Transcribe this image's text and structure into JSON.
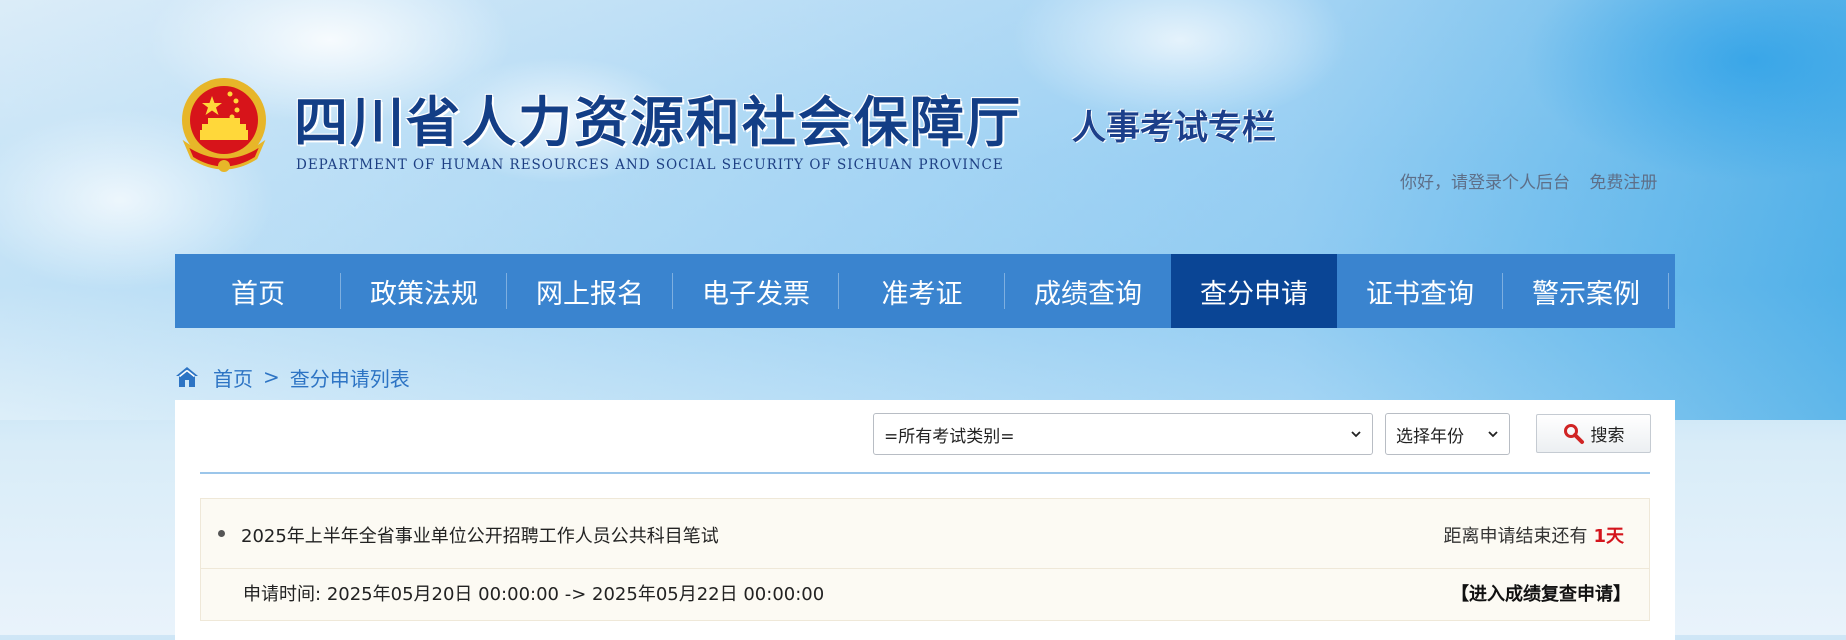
{
  "header": {
    "title": "四川省人力资源和社会保障厅",
    "subtitle": "DEPARTMENT OF HUMAN RESOURCES AND SOCIAL SECURITY OF SICHUAN PROVINCE",
    "column": "人事考试专栏",
    "emblem_icon": "national-emblem-icon",
    "login_link": "你好，请登录个人后台",
    "register_link": "免费注册"
  },
  "nav": {
    "items": [
      {
        "label": "首页"
      },
      {
        "label": "政策法规"
      },
      {
        "label": "网上报名"
      },
      {
        "label": "电子发票"
      },
      {
        "label": "准考证"
      },
      {
        "label": "成绩查询"
      },
      {
        "label": "查分申请"
      },
      {
        "label": "证书查询"
      },
      {
        "label": "警示案例"
      }
    ],
    "active": "查分申请",
    "color": "#3a84cf",
    "active_color": "#0a4595"
  },
  "breadcrumb": {
    "icon": "home-icon",
    "home": "首页",
    "separator": ">",
    "current": "查分申请列表"
  },
  "filters": {
    "exam_type": {
      "selected": "=所有考试类别="
    },
    "year": {
      "selected": "选择年份"
    },
    "search_label": "搜索",
    "search_icon": "magnifier-icon"
  },
  "list": [
    {
      "title": "2025年上半年全省事业单位公开招聘工作人员公共科目笔试",
      "remain_prefix": "距离申请结束还有",
      "remain_value": "1天",
      "time_label": "申请时间:",
      "time_range": "2025年05月20日 00:00:00 -> 2025年05月22日 00:00:00",
      "action": "【进入成绩复查申请】"
    }
  ],
  "colors": {
    "accent_blue": "#2d74c4",
    "warning_red": "#d4151d",
    "title_navy": "#133e86"
  }
}
